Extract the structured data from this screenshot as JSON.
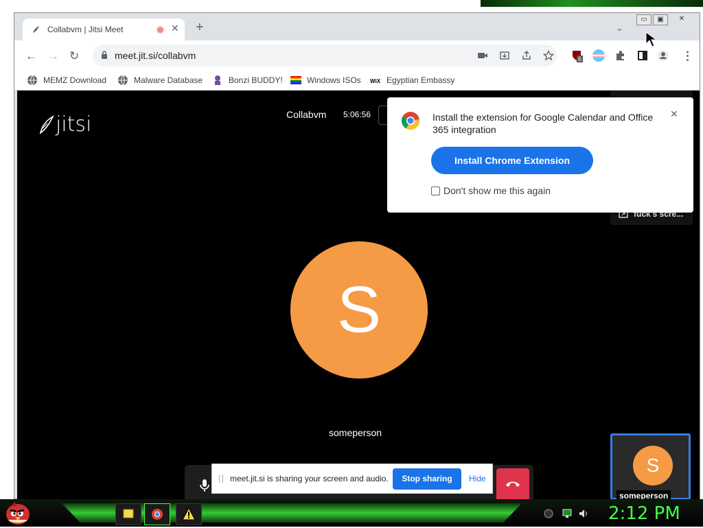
{
  "browser": {
    "tab": {
      "title": "Collabvm | Jitsi Meet"
    },
    "address": {
      "url": "meet.jit.si/collabvm"
    },
    "bookmarks": [
      {
        "label": "MEMZ Download",
        "icon": "globe-icon"
      },
      {
        "label": "Malware Database",
        "icon": "globe-icon"
      },
      {
        "label": "Bonzi BUDDY!",
        "icon": "bonzi-icon"
      },
      {
        "label": "Windows ISOs",
        "icon": "rainbow-flag-icon"
      },
      {
        "label": "Egyptian Embassy",
        "icon": "wix-icon"
      }
    ],
    "extension_badge": "6"
  },
  "meeting": {
    "logo_text": "jitsi",
    "title": "Collabvm",
    "time": "5:06:56",
    "main_avatar_letter": "S",
    "main_name": "someperson",
    "thumb_top_label": "fuck's scre...",
    "thumb_bottom_letter": "S",
    "thumb_bottom_name": "someperson",
    "colors": {
      "avatar": "#f59a45",
      "hangup": "#e0344d",
      "active_border": "#3b7ce0"
    }
  },
  "popup": {
    "message": "Install the extension for Google Calendar and Office 365 integration",
    "install_label": "Install Chrome Extension",
    "dont_show_label": "Don't show me this again"
  },
  "sharebar": {
    "message": "meet.jit.si is sharing your screen and audio.",
    "stop_label": "Stop sharing",
    "hide_label": "Hide"
  },
  "taskbar": {
    "clock": "2:12 PM",
    "accent": "#44ff44"
  }
}
